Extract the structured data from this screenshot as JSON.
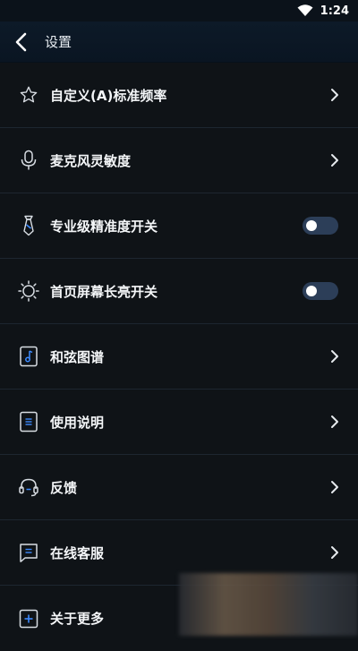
{
  "statusbar": {
    "time": "1:24"
  },
  "header": {
    "title": "设置"
  },
  "items": [
    {
      "label": "自定义(A)标准频率",
      "icon": "star-icon",
      "control": "chevron"
    },
    {
      "label": "麦克风灵敏度",
      "icon": "microphone-icon",
      "control": "chevron"
    },
    {
      "label": "专业级精准度开关",
      "icon": "tie-icon",
      "control": "toggle",
      "toggle_on": false
    },
    {
      "label": "首页屏幕长亮开关",
      "icon": "sun-icon",
      "control": "toggle",
      "toggle_on": false
    },
    {
      "label": "和弦图谱",
      "icon": "music-note-icon",
      "control": "chevron"
    },
    {
      "label": "使用说明",
      "icon": "document-icon",
      "control": "chevron"
    },
    {
      "label": "反馈",
      "icon": "headset-icon",
      "control": "chevron"
    },
    {
      "label": "在线客服",
      "icon": "chat-icon",
      "control": "chevron"
    },
    {
      "label": "关于更多",
      "icon": "plus-box-icon",
      "control": "none"
    }
  ],
  "colors": {
    "background": "#0f1317",
    "header": "#0d1a28",
    "toggle_track": "#2c3e58",
    "accent": "#3d8bff"
  }
}
